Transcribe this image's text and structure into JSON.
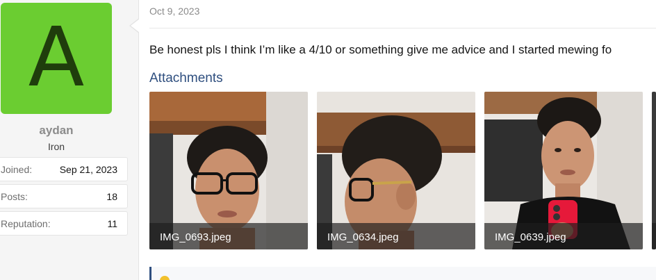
{
  "user": {
    "avatar_letter": "A",
    "avatar_color": "#6bcd31",
    "name": "aydan",
    "title": "Iron",
    "stats": [
      {
        "label": "Joined:",
        "value": "Sep 21, 2023"
      },
      {
        "label": "Posts:",
        "value": "18"
      },
      {
        "label": "Reputation:",
        "value": "11"
      }
    ]
  },
  "post": {
    "date": "Oct 9, 2023",
    "body": "Be honest pls I think I’m like a 4/10 or something give me advice and I started mewing fo",
    "attachments_heading": "Attachments",
    "attachments": [
      {
        "filename": "IMG_0693.jpeg"
      },
      {
        "filename": "IMG_0634.jpeg"
      },
      {
        "filename": "IMG_0639.jpeg"
      }
    ]
  },
  "colors": {
    "accent": "#2f4f7f",
    "avatar_text": "#1f3d0c"
  }
}
